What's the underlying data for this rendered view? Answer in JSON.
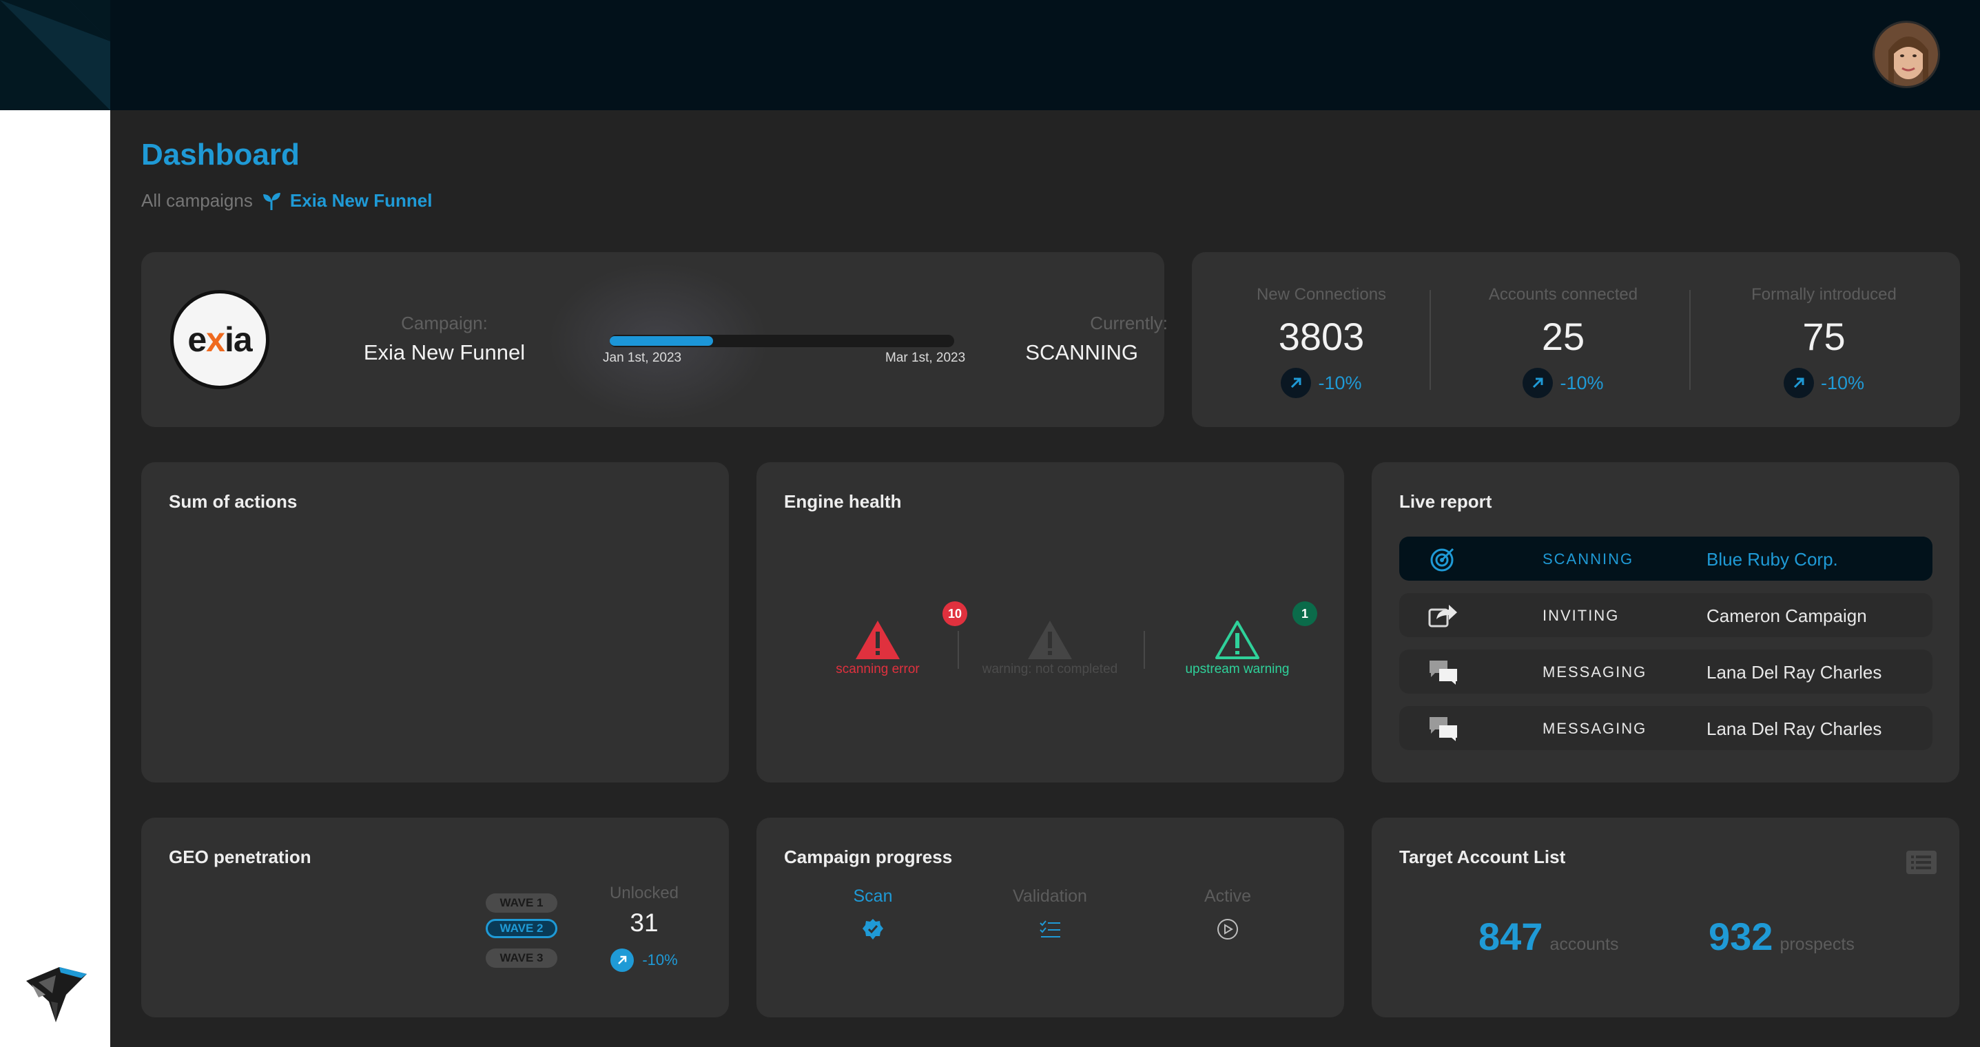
{
  "page": {
    "title": "Dashboard",
    "breadcrumb": {
      "root": "All campaigns",
      "current": "Exia New Funnel"
    }
  },
  "campaign": {
    "logo_text_a": "e",
    "logo_text_x": "x",
    "logo_text_b": "ia",
    "campaign_label": "Campaign:",
    "campaign_name": "Exia New Funnel",
    "start_date": "Jan 1st, 2023",
    "end_date": "Mar 1st, 2023",
    "progress_fraction": 0.3,
    "currently_label": "Currently:",
    "currently_value": "SCANNING"
  },
  "stats": [
    {
      "label": "New Connections",
      "value": "3803",
      "change": "-10%"
    },
    {
      "label": "Accounts connected",
      "value": "25",
      "change": "-10%"
    },
    {
      "label": "Formally introduced",
      "value": "75",
      "change": "-10%"
    }
  ],
  "sum_of_actions": {
    "title": "Sum of actions"
  },
  "engine_health": {
    "title": "Engine health",
    "items": [
      {
        "label": "scanning error",
        "badge": "10",
        "icon": "warning-filled-icon",
        "color": "#e0313e"
      },
      {
        "label": "warning: not completed",
        "badge": "",
        "icon": "warning-muted-icon",
        "color": "#484848"
      },
      {
        "label": "upstream warning",
        "badge": "1",
        "icon": "warning-outline-icon",
        "color": "#2fd19a"
      }
    ]
  },
  "live_report": {
    "title": "Live report",
    "rows": [
      {
        "icon": "radar-icon",
        "status": "SCANNING",
        "name": "Blue Ruby Corp."
      },
      {
        "icon": "share-icon",
        "status": "INVITING",
        "name": "Cameron Campaign"
      },
      {
        "icon": "chat-icon",
        "status": "MESSAGING",
        "name": "Lana Del Ray Charles"
      },
      {
        "icon": "chat-icon",
        "status": "MESSAGING",
        "name": "Lana Del Ray Charles"
      }
    ]
  },
  "geo": {
    "title": "GEO penetration",
    "waves": [
      "WAVE 1",
      "WAVE 2",
      "WAVE 3"
    ],
    "active_wave": "WAVE 2",
    "unlocked_label": "Unlocked",
    "unlocked_value": "31",
    "unlocked_change": "-10%"
  },
  "campaign_progress": {
    "title": "Campaign progress",
    "steps": [
      {
        "label": "Scan",
        "icon": "verified-badge-icon",
        "active": true
      },
      {
        "label": "Validation",
        "icon": "checklist-icon",
        "active": false
      },
      {
        "label": "Active",
        "icon": "play-circle-icon",
        "active": false
      }
    ]
  },
  "target_account_list": {
    "title": "Target Account List",
    "accounts_value": "847",
    "accounts_unit": "accounts",
    "prospects_value": "932",
    "prospects_unit": "prospects"
  },
  "colors": {
    "accent": "#1f9ad6",
    "error": "#e0313e",
    "success": "#2fd19a",
    "card": "#313131",
    "background": "#232323",
    "topbar": "#02111a"
  }
}
